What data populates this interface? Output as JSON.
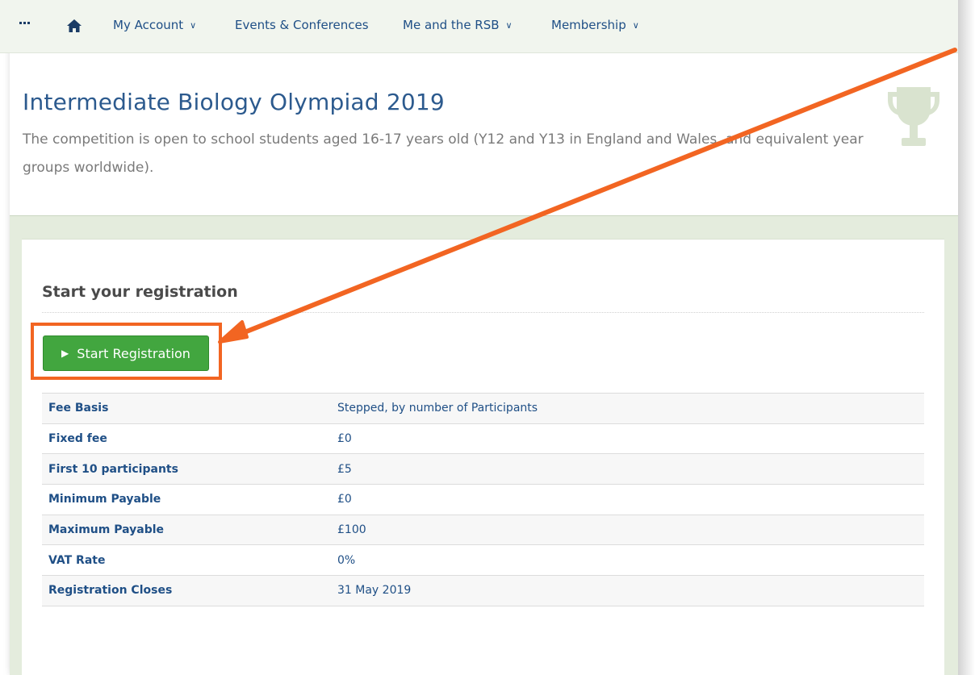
{
  "nav": {
    "menu_icon": "ellipsis-icon",
    "home_icon": "home-icon",
    "items": [
      {
        "label": "My Account",
        "has_dropdown": true
      },
      {
        "label": "Events & Conferences",
        "has_dropdown": false
      },
      {
        "label": "Me and the RSB",
        "has_dropdown": true
      },
      {
        "label": "Membership",
        "has_dropdown": true
      }
    ],
    "dropdown_glyph": "∨"
  },
  "header": {
    "title": "Intermediate Biology Olympiad 2019",
    "description": "The competition is open to school students aged 16-17 years old (Y12 and Y13 in England and Wales, and equivalent year groups worldwide).",
    "icon": "trophy-icon"
  },
  "registration": {
    "section_title": "Start your registration",
    "button_label": "Start Registration",
    "button_icon": "play-icon",
    "fees": [
      {
        "label": "Fee Basis",
        "value": "Stepped, by number of Participants"
      },
      {
        "label": "Fixed fee",
        "value": "£0"
      },
      {
        "label": "First 10 participants",
        "value": "£5"
      },
      {
        "label": "Minimum Payable",
        "value": "£0"
      },
      {
        "label": "Maximum Payable",
        "value": "£100"
      },
      {
        "label": "VAT Rate",
        "value": "0%"
      },
      {
        "label": "Registration Closes",
        "value": "31 May 2019"
      }
    ]
  },
  "colors": {
    "nav_text": "#1f4f86",
    "title": "#2c5a8e",
    "button": "#42a63f",
    "annotation": "#f26522",
    "page_bg": "#e4ecdd"
  }
}
